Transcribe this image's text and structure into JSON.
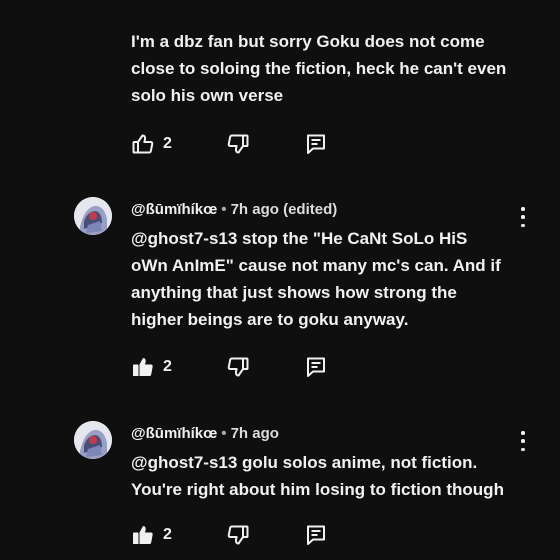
{
  "comments": [
    {
      "author": "",
      "time": "",
      "text_lines": [
        "I'm a dbz fan but sorry Goku does not come",
        "close to soloing the fiction, heck he can't even",
        "solo his own verse"
      ],
      "likes": "2",
      "liked": false
    },
    {
      "author": "@ßūmïhíkœ",
      "time": "7h ago (edited)",
      "text_lines": [
        " @ghost7-s13 stop the \"He CaNt SoLo HiS",
        "oWn AnImE\" cause not many mc's can. And if",
        "anything that just shows how strong the",
        "higher beings are to goku anyway."
      ],
      "likes": "2",
      "liked": true
    },
    {
      "author": "@ßūmïhíkœ",
      "time": "7h ago",
      "text_lines": [
        " @ghost7-s13 golu solos anime, not fiction.",
        "You're right about him losing to fiction though"
      ],
      "likes": "2",
      "liked": true
    }
  ],
  "separator": "•",
  "icons": {
    "like": "thumbs-up-icon",
    "dislike": "thumbs-down-icon",
    "reply": "reply-icon",
    "more": "more-vert-icon"
  }
}
